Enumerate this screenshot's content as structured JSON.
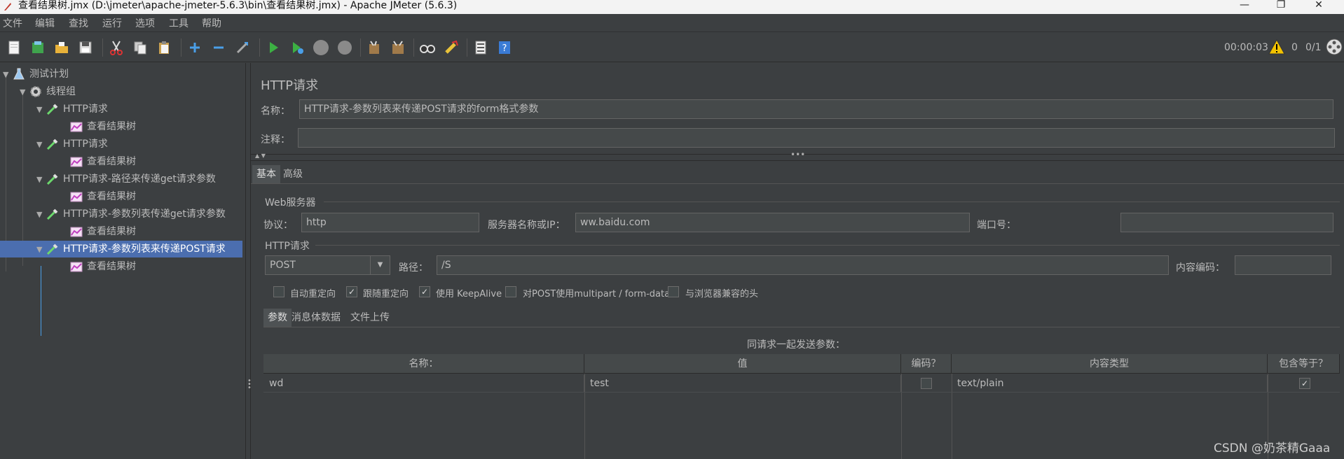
{
  "window": {
    "title": "查看结果树.jmx (D:\\jmeter\\apache-jmeter-5.6.3\\bin\\查看结果树.jmx) - Apache JMeter (5.6.3)",
    "min": "—",
    "max": "❐",
    "close": "✕"
  },
  "menu": [
    "文件",
    "编辑",
    "查找",
    "运行",
    "选项",
    "工具",
    "帮助"
  ],
  "status": {
    "elapsed": "00:00:03",
    "warnings": "0",
    "threads": "0/1"
  },
  "tree": {
    "plan": "测试计划",
    "thread_group": "线程组",
    "nodes": [
      {
        "label": "HTTP请求",
        "child": "查看结果树"
      },
      {
        "label": "HTTP请求",
        "child": "查看结果树"
      },
      {
        "label": "HTTP请求-路径来传递get请求参数",
        "child": "查看结果树"
      },
      {
        "label": "HTTP请求-参数列表传递get请求参数",
        "child": "查看结果树"
      },
      {
        "label": "HTTP请求-参数列表来传递POST请求",
        "child": "查看结果树"
      }
    ]
  },
  "panel": {
    "title": "HTTP请求",
    "name_label": "名称：",
    "name_value": "HTTP请求-参数列表来传递POST请求的form格式参数",
    "comment_label": "注释：",
    "comment_value": "",
    "tabs": [
      "基本",
      "高级"
    ],
    "web_server": {
      "title": "Web服务器",
      "protocol_label": "协议：",
      "protocol": "http",
      "server_label": "服务器名称或IP：",
      "server": "ww.baidu.com",
      "port_label": "端口号：",
      "port": ""
    },
    "http_request": {
      "title": "HTTP请求",
      "method": "POST",
      "path_label": "路径：",
      "path": "/S",
      "encoding_label": "内容编码：",
      "encoding": ""
    },
    "checkboxes": [
      {
        "label": "自动重定向",
        "checked": false,
        "mark": ""
      },
      {
        "label": "跟随重定向",
        "checked": true,
        "mark": "✓"
      },
      {
        "label": "使用 KeepAlive",
        "checked": true,
        "mark": "✓"
      },
      {
        "label": "对POST使用multipart / form-data",
        "checked": false,
        "mark": ""
      },
      {
        "label": "与浏览器兼容的头",
        "checked": false,
        "mark": ""
      }
    ],
    "subtabs": [
      "参数",
      "消息体数据",
      "文件上传"
    ],
    "params_caption": "同请求一起发送参数：",
    "columns": [
      "名称：",
      "值",
      "编码？",
      "内容类型",
      "包含等于？"
    ],
    "rows": [
      {
        "name": "wd",
        "value": "test",
        "encode": "",
        "content_type": "text/plain",
        "include_equals": "✓"
      }
    ]
  },
  "watermark": "CSDN @奶茶精Gaaa",
  "colors": {
    "background": "#3c3f41",
    "selection": "#4b6eaf",
    "field": "#45494a"
  }
}
